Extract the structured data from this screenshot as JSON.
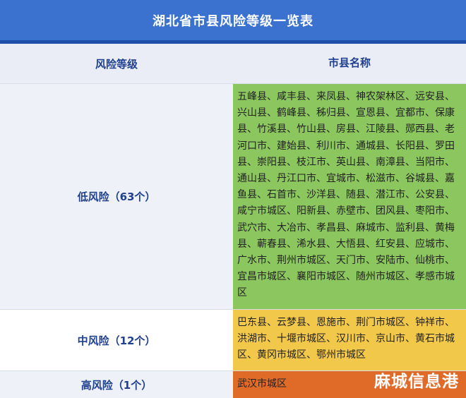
{
  "title": "湖北省市县风险等级一览表",
  "header": {
    "level": "风险等级",
    "names": "市县名称"
  },
  "rows": [
    {
      "level": "低风险（63个）",
      "names": "五峰县、咸丰县、来凤县、神农架林区、远安县、兴山县、鹤峰县、秭归县、宣恩县、宜都市、保康县、竹溪县、竹山县、房县、江陵县、郧西县、老河口市、建始县、利川市、通城县、长阳县、罗田县、崇阳县、枝江市、英山县、南漳县、当阳市、通山县、丹江口市、宜城市、松滋市、谷城县、嘉鱼县、石首市、沙洋县、随县、潜江市、公安县、咸宁市城区、阳新县、赤壁市、团风县、枣阳市、武穴市、大冶市、孝昌县、麻城市、监利县、黄梅县、蕲春县、浠水县、大悟县、红安县、应城市、广水市、荆州市城区、天门市、安陆市、仙桃市、宜昌市城区、襄阳市城区、随州市城区、孝感市城区",
      "color": "#8cc65e"
    },
    {
      "level": "中风险（12个）",
      "names": "巴东县、云梦县、恩施市、荆门市城区、钟祥市、洪湖市、十堰市城区、汉川市、京山市、黄石市城区、黄冈市城区、鄂州市城区",
      "color": "#f2c84a"
    },
    {
      "level": "高风险（1个）",
      "names": "武汉市城区",
      "color": "#e06a28"
    }
  ],
  "watermark": "麻城信息港"
}
